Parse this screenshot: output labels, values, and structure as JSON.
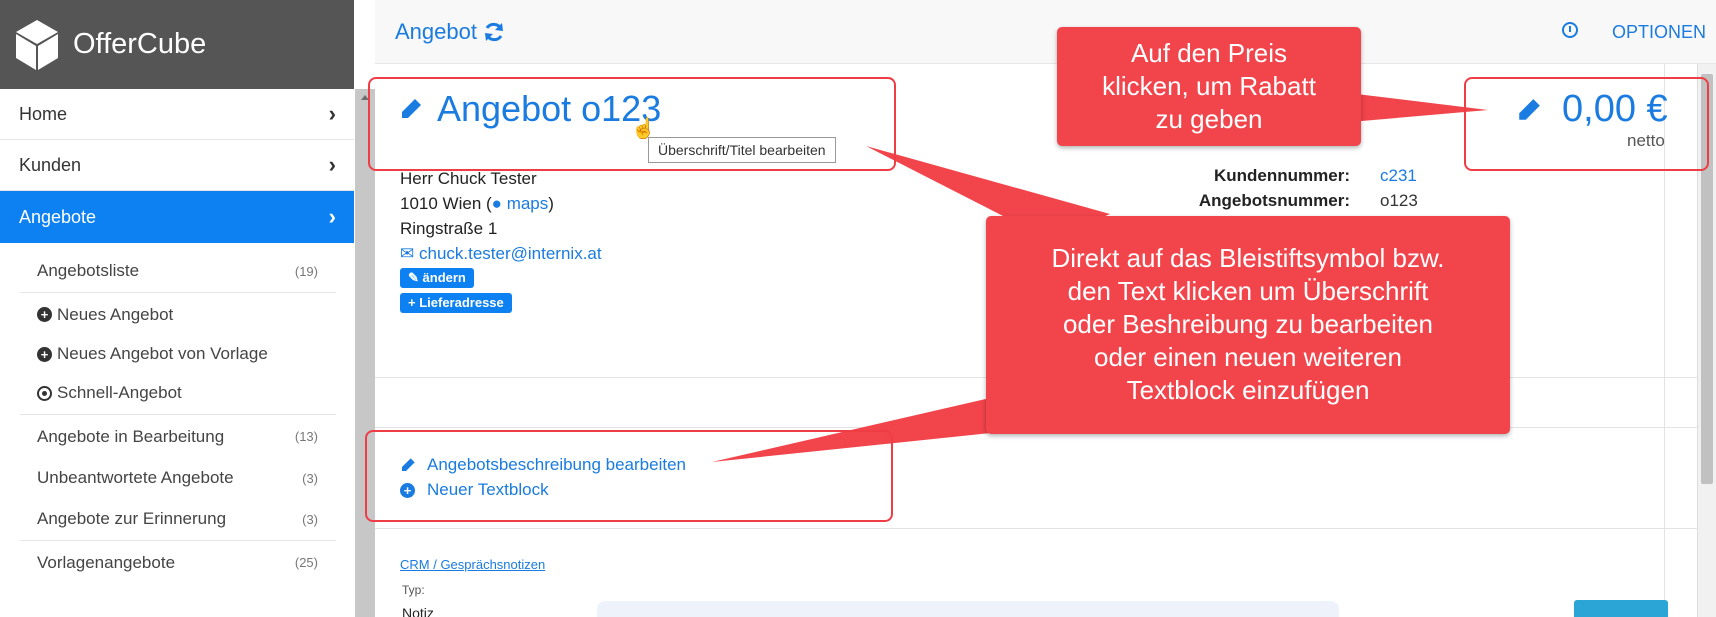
{
  "brand": {
    "name": "OfferCube",
    "icon": "cube-logo-icon"
  },
  "nav": {
    "items": [
      {
        "label": "Home",
        "active": false
      },
      {
        "label": "Kunden",
        "active": false
      },
      {
        "label": "Angebote",
        "active": true
      }
    ],
    "chevron": "›"
  },
  "subnav": {
    "list": {
      "label": "Angebotsliste",
      "count": "(19)"
    },
    "actions": [
      {
        "label": "Neues Angebot",
        "icon": "plus-circle-icon"
      },
      {
        "label": "Neues Angebot von Vorlage",
        "icon": "plus-circle-icon"
      },
      {
        "label": "Schnell-Angebot",
        "icon": "dot-circle-icon"
      }
    ],
    "groups": [
      {
        "label": "Angebote in Bearbeitung",
        "count": "(13)"
      },
      {
        "label": "Unbeantwortete Angebote",
        "count": "(3)"
      },
      {
        "label": "Angebote zur Erinnerung",
        "count": "(3)"
      }
    ],
    "templates": {
      "label": "Vorlagenangebote",
      "count": "(25)"
    }
  },
  "topbar": {
    "title": "Angebot",
    "options_label": "OPTIONEN"
  },
  "offer": {
    "title": "Angebot o123",
    "tooltip": "Überschrift/Titel bearbeiten",
    "customer_name": "Herr Chuck Tester",
    "city_prefix": "1010 Wien (",
    "maps_label": "maps",
    "city_suffix": ")",
    "street": "Ringstraße 1",
    "email": "chuck.tester@internix.at",
    "edit_badge": "ändern",
    "delivery_badge": "Lieferadresse",
    "customer_number_label": "Kundennummer:",
    "customer_number": "c231",
    "offer_number_label": "Angebotsnummer:",
    "offer_number": "o123",
    "price": "0,00 €",
    "price_note": "netto",
    "description_link": "Angebotsbeschreibung bearbeiten",
    "new_block": "Neuer Textblock",
    "crm_link": "CRM / Gesprächsnotizen",
    "type_label": "Typ:",
    "type_value": "Notiz"
  },
  "annotations": {
    "price_hint": [
      "Auf den Preis",
      "klicken, um Rabatt",
      "zu geben"
    ],
    "pencil_hint": [
      "Direkt auf das Bleistiftsymbol bzw.",
      "den Text klicken um Überschrift",
      "oder Beshreibung zu bearbeiten",
      "oder einen neuen weiteren",
      "Textblock einzufügen"
    ]
  },
  "colors": {
    "accent": "#1a7be0",
    "active_nav": "#0d80f2",
    "callout": "#f2444b",
    "brand_bar": "#555555"
  }
}
